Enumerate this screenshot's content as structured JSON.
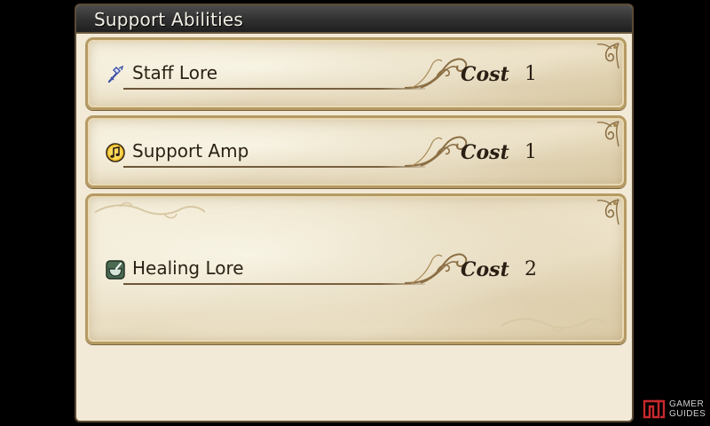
{
  "panel": {
    "title": "Support Abilities"
  },
  "abilities": [
    {
      "name": "Staff Lore",
      "cost_label": "Cost",
      "cost": "1",
      "icon": "staff-icon"
    },
    {
      "name": "Support Amp",
      "cost_label": "Cost",
      "cost": "1",
      "icon": "music-note-icon"
    },
    {
      "name": "Healing Lore",
      "cost_label": "Cost",
      "cost": "2",
      "icon": "mortar-pestle-icon"
    }
  ],
  "watermark": {
    "line1": "GAMER",
    "line2": "GUIDES"
  },
  "colors": {
    "background": "#000000",
    "panel": "#f2ead6",
    "header": "#2e2e2e",
    "card_border": "#b59a63",
    "text": "#2a1f14",
    "ornament": "#8c6f45",
    "watermark_red": "#c8282d"
  }
}
